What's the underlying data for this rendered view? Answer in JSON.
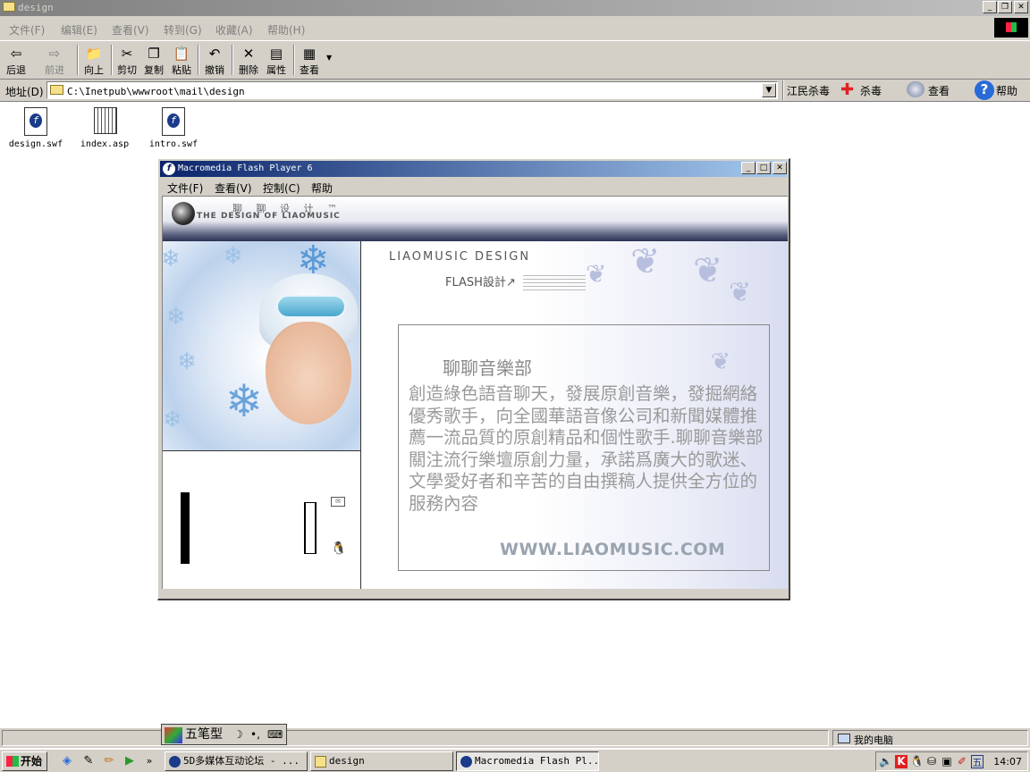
{
  "explorer": {
    "title": "design",
    "menu": [
      "文件(F)",
      "编辑(E)",
      "查看(V)",
      "转到(G)",
      "收藏(A)",
      "帮助(H)"
    ],
    "toolbar": {
      "back": "后退",
      "forward": "前进",
      "up": "向上",
      "cut": "剪切",
      "copy": "复制",
      "paste": "粘贴",
      "undo": "撤销",
      "delete": "删除",
      "properties": "属性",
      "views": "查看"
    },
    "address_label": "地址(D)",
    "address_value": "C:\\Inetpub\\wwwroot\\mail\\design",
    "antivirus": {
      "label": "江民杀毒",
      "scan": "杀毒",
      "check": "查看",
      "help": "帮助"
    },
    "files": [
      "design.swf",
      "index.asp",
      "intro.swf"
    ]
  },
  "flash_player": {
    "title": "Macromedia Flash Player 6",
    "menu": [
      "文件(F)",
      "查看(V)",
      "控制(C)",
      "帮助"
    ],
    "banner_top": "聊 聊 设 计 ™",
    "banner_sub": "THE DESIGN OF LIAOMUSIC",
    "design_label": "LIAOMUSIC DESIGN",
    "flash_label": "FLASH設計↗",
    "club_title": "聊聊音樂部",
    "club_body": "創造綠色語音聊天，發展原創音樂，發掘網絡優秀歌手，向全國華語音像公司和新聞媒體推薦一流品質的原創精品和個性歌手.聊聊音樂部關注流行樂壇原創力量，承諾爲廣大的歌迷、文學愛好者和辛苦的自由撰稿人提供全方位的服務內容",
    "url": "WWW.LIAOMUSIC.COM"
  },
  "statusbar": {
    "computer": "我的电脑"
  },
  "ime": {
    "mode": "五笔型"
  },
  "taskbar": {
    "start": "开始",
    "tasks": [
      {
        "label": "5D多媒体互动论坛 - ..."
      },
      {
        "label": "design"
      },
      {
        "label": "Macromedia Flash Pl..."
      }
    ],
    "ime_indicator": "五",
    "clock": "14:07"
  },
  "colors": {
    "title_active": "#0a246a",
    "title_inactive": "#808080",
    "face": "#d4d0c8"
  }
}
